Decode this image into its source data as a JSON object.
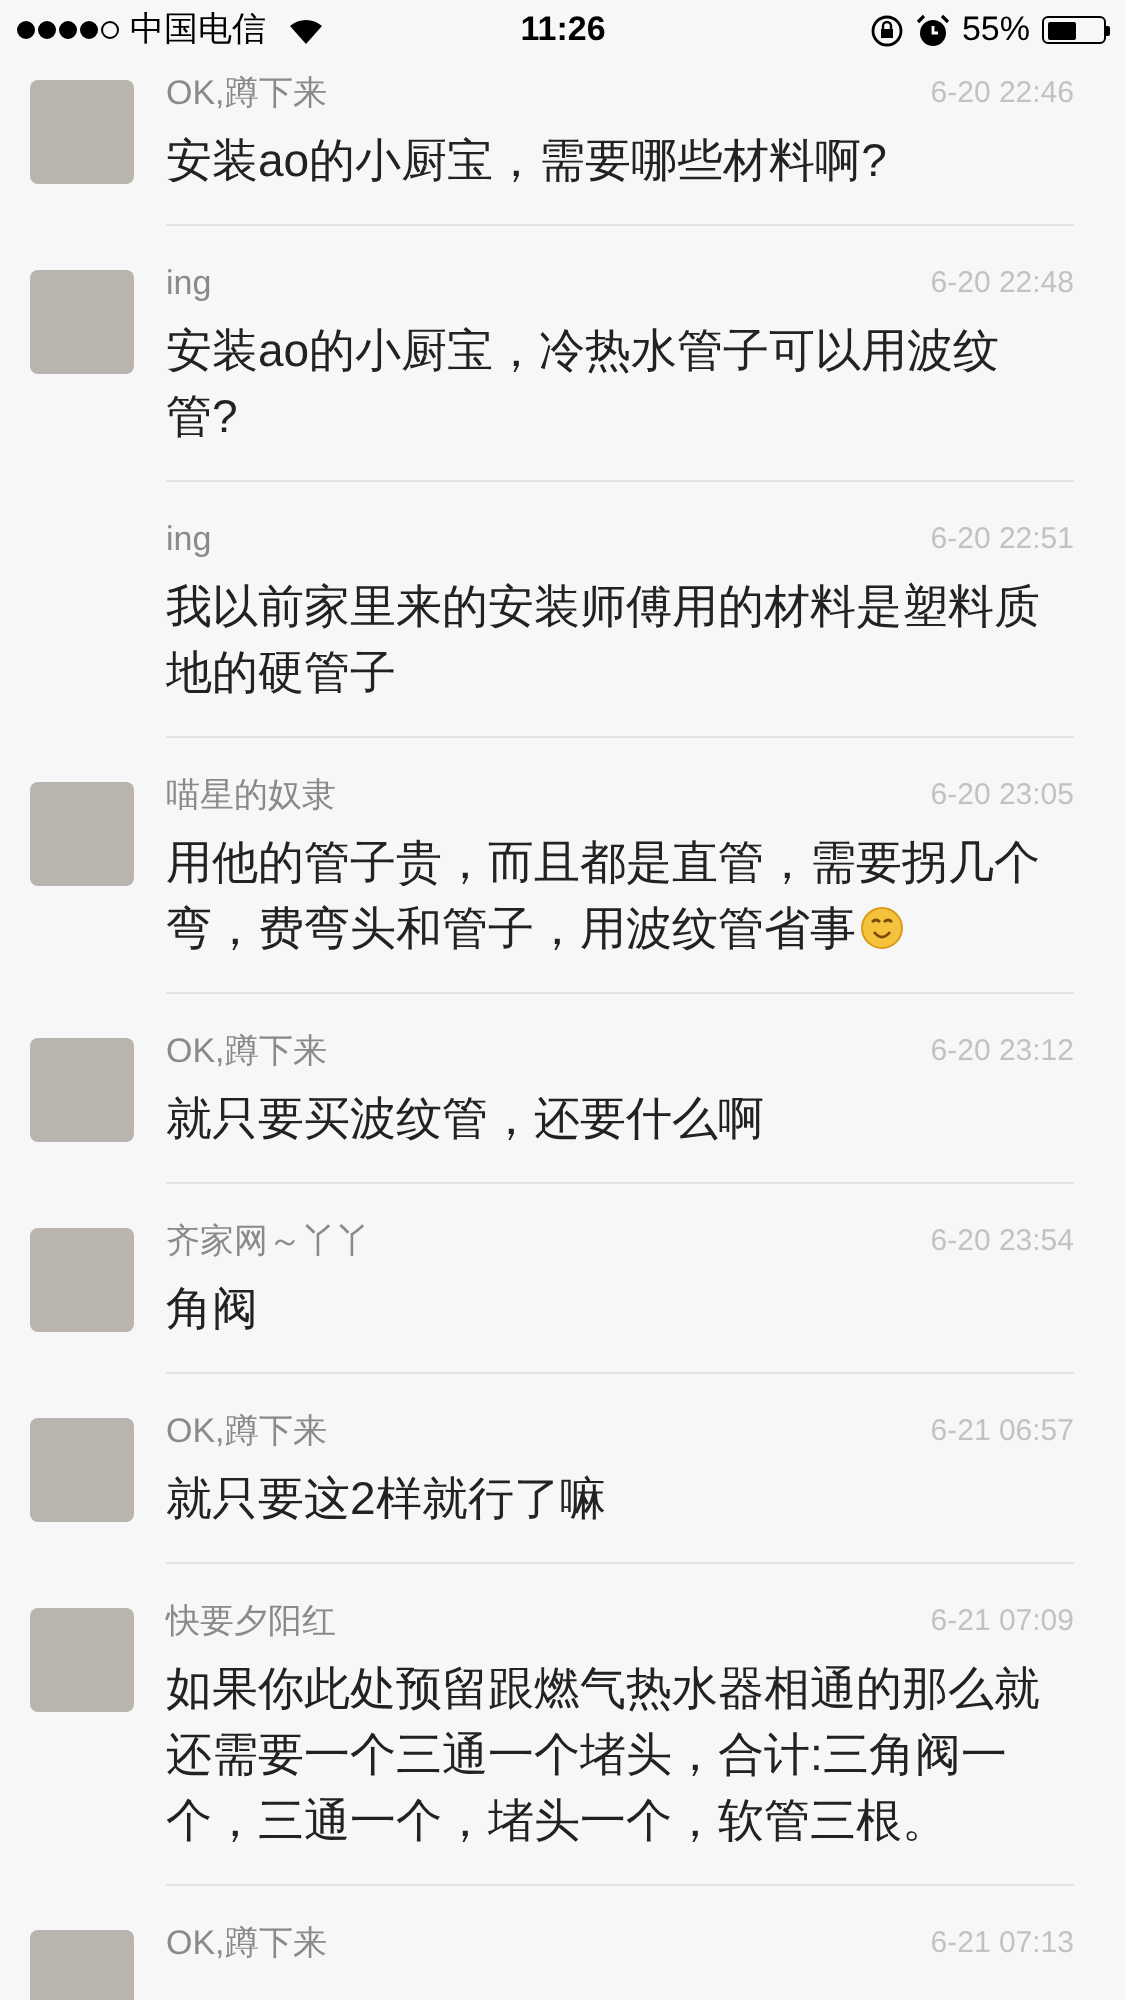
{
  "status_bar": {
    "carrier": "中国电信",
    "time": "11:26",
    "battery_percent": "55%",
    "battery": {
      "level": 0.55
    }
  },
  "comments": [
    {
      "name": "OK,蹲下来",
      "time": "6-20 22:46",
      "message": "安装ao的小厨宝，需要哪些材料啊?",
      "has_avatar": true,
      "emoji": false
    },
    {
      "name": "ing",
      "time": "6-20 22:48",
      "message": "安装ao的小厨宝，冷热水管子可以用波纹管?",
      "has_avatar": true,
      "emoji": false
    },
    {
      "name": "ing",
      "time": "6-20 22:51",
      "message": "我以前家里来的安装师傅用的材料是塑料质地的硬管子",
      "has_avatar": false,
      "emoji": false
    },
    {
      "name": "喵星的奴隶",
      "time": "6-20 23:05",
      "message": "用他的管子贵，而且都是直管，需要拐几个弯，费弯头和管子，用波纹管省事",
      "has_avatar": true,
      "emoji": true
    },
    {
      "name": "OK,蹲下来",
      "time": "6-20 23:12",
      "message": "就只要买波纹管，还要什么啊",
      "has_avatar": true,
      "emoji": false
    },
    {
      "name": "齐家网～丫丫",
      "time": "6-20 23:54",
      "message": "角阀",
      "has_avatar": true,
      "emoji": false
    },
    {
      "name": "OK,蹲下来",
      "time": "6-21 06:57",
      "message": "就只要这2样就行了嘛",
      "has_avatar": true,
      "emoji": false
    },
    {
      "name": "快要夕阳红",
      "time": "6-21 07:09",
      "message": "如果你此处预留跟燃气热水器相通的那么就还需要一个三通一个堵头，合计:三角阀一个，三通一个，堵头一个，软管三根。",
      "has_avatar": true,
      "emoji": false
    },
    {
      "name": "OK,蹲下来",
      "time": "6-21 07:13",
      "has_avatar": true,
      "emoji": false
    }
  ]
}
